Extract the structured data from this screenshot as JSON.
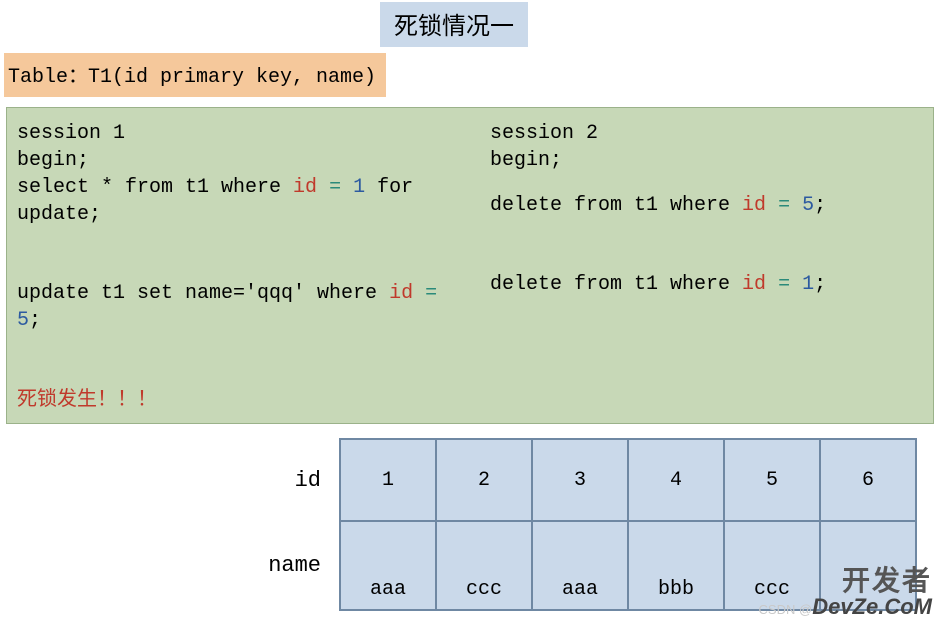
{
  "title": "死锁情况一",
  "schema": "Table：T1(id primary key, name)",
  "session1": {
    "name": "session 1",
    "begin": "begin;",
    "line1_pre": "select * from t1 where ",
    "line1_id": "id",
    "line1_eq": " = ",
    "line1_val": "1",
    "line1_post": " for update;",
    "line2_pre": "update t1 set name='qqq'  where ",
    "line2_id": "id",
    "line2_eq": " = ",
    "line2_val": "5",
    "line2_post": ";"
  },
  "session2": {
    "name": "session 2",
    "begin": "begin;",
    "line1_pre": "delete from t1 where ",
    "line1_id": "id",
    "line1_eq": " = ",
    "line1_val": "5",
    "line1_post": ";",
    "line2_pre": "delete from t1 where ",
    "line2_id": "id",
    "line2_eq": " = ",
    "line2_val": "1",
    "line2_post": ";"
  },
  "deadlock_note": "死锁发生！！！",
  "table": {
    "row_id_label": "id",
    "row_name_label": "name",
    "ids": [
      "1",
      "2",
      "3",
      "4",
      "5",
      "6"
    ],
    "names": [
      "aaa",
      "ccc",
      "aaa",
      "bbb",
      "ccc",
      ""
    ]
  },
  "watermark": {
    "top": "开发者",
    "csdn": "CSDN @",
    "bottom": "DevZe.CoM"
  }
}
